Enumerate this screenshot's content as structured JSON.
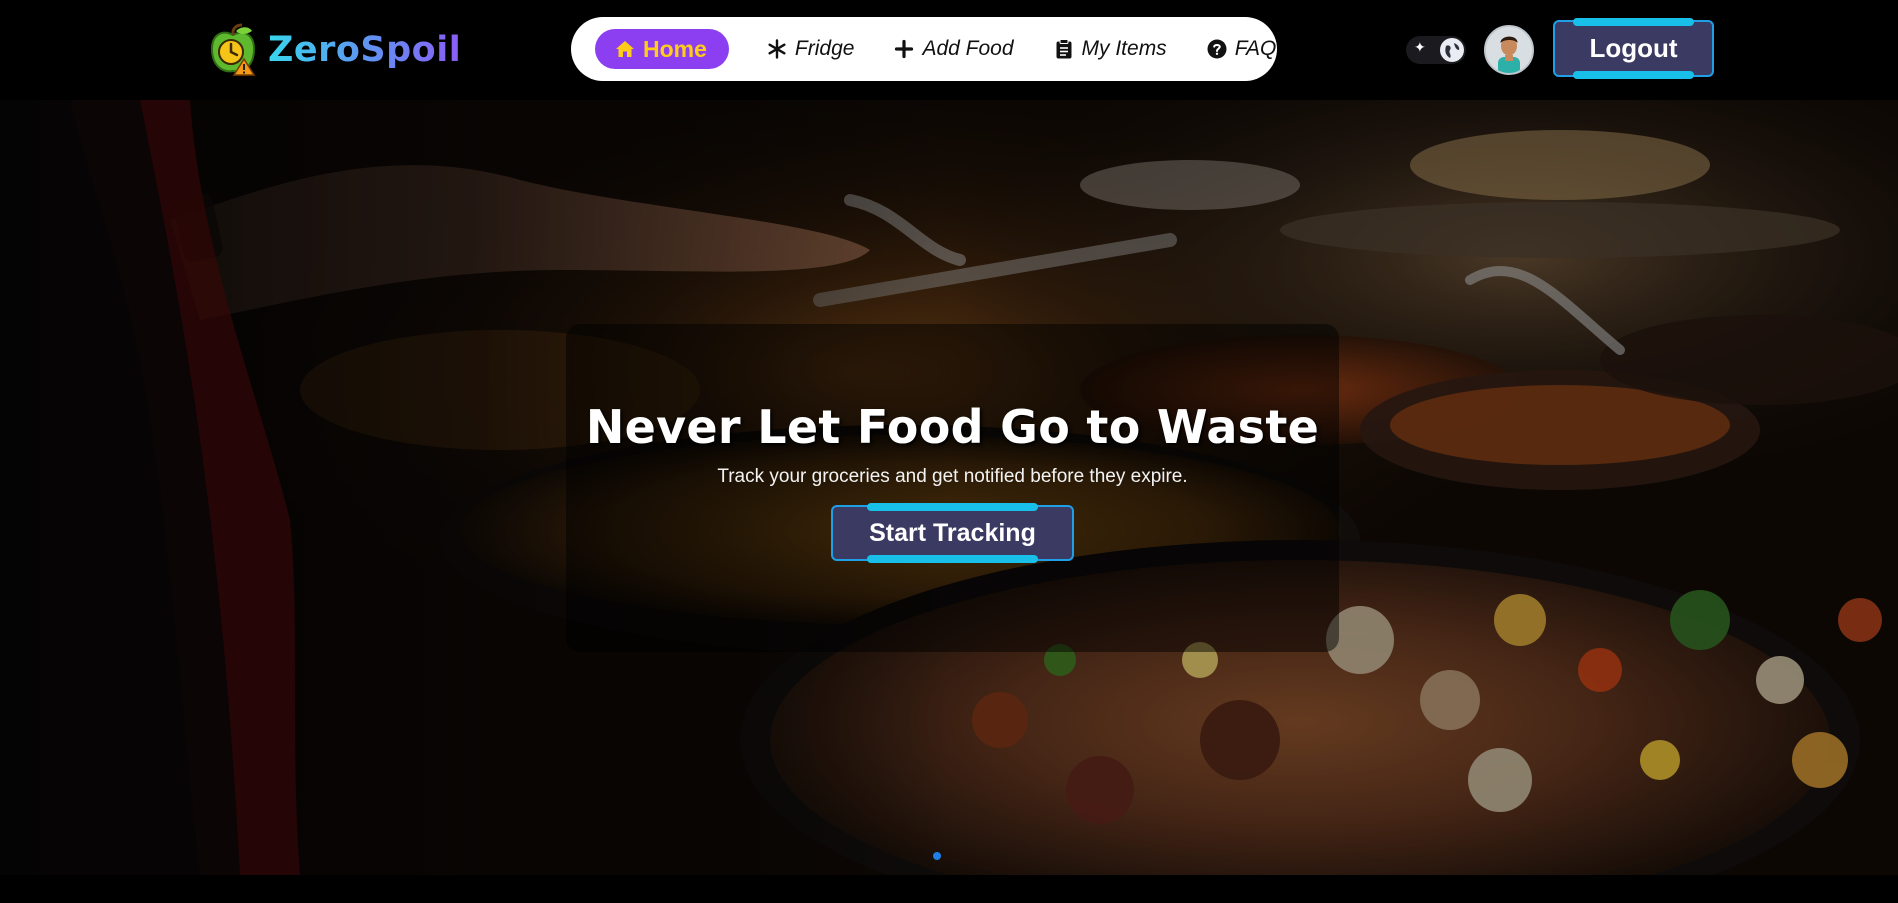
{
  "brand": {
    "name": "ZeroSpoil",
    "logo_icon": "apple-clock-warning-icon"
  },
  "nav": {
    "items": [
      {
        "label": "Home",
        "icon": "home-icon",
        "active": true
      },
      {
        "label": "Fridge",
        "icon": "snowflake-icon",
        "active": false
      },
      {
        "label": "Add Food",
        "icon": "plus-icon",
        "active": false
      },
      {
        "label": "My Items",
        "icon": "clipboard-icon",
        "active": false
      },
      {
        "label": "FAQ",
        "icon": "question-circle-icon",
        "active": false
      }
    ]
  },
  "header": {
    "theme_toggle_icon": "sparkle-globe-icon",
    "avatar_icon": "user-avatar",
    "logout_label": "Logout"
  },
  "hero": {
    "title": "Never Let Food Go to Waste",
    "subtitle": "Track your groceries and get notified before they expire.",
    "cta_label": "Start Tracking",
    "background": "buffet-food-photo",
    "slide_count": 1,
    "active_slide": 1
  },
  "colors": {
    "accent_purple": "#8b3ff0",
    "accent_yellow": "#ffcc1a",
    "button_bg": "#3a3a62",
    "button_border": "#1fa0e6",
    "button_bar": "#17bfe9",
    "dot_active": "#1f7fe8"
  }
}
